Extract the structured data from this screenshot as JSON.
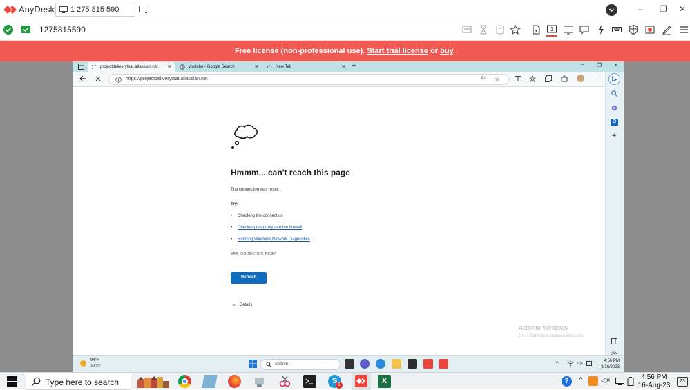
{
  "anydesk": {
    "app_name": "AnyDesk",
    "address": "1 275 815 590",
    "session_id": "1275815590",
    "brand_color": "#ef443b",
    "window_controls": [
      "–",
      "❐",
      "✕"
    ],
    "toolbar_icons": [
      "chat-disabled-icon",
      "hourglass-icon",
      "database-icon",
      "star-icon",
      "file-transfer-icon",
      "monitor-select-icon",
      "display-icon",
      "chat-icon",
      "actions-icon",
      "keyboard-icon",
      "permissions-icon",
      "record-icon",
      "whiteboard-icon",
      "menu-icon"
    ]
  },
  "banner": {
    "prefix": "Free license (non-professional use). ",
    "trial_link": "Start trial license",
    "mid": " or ",
    "buy_link": "buy",
    "suffix": ".",
    "color": "#f15a53"
  },
  "browser": {
    "tabs": [
      {
        "label": "projectdeliverytsat.atlassian.net",
        "active": true
      },
      {
        "label": "youtube - Google Search",
        "active": false
      },
      {
        "label": "New Tab",
        "active": false
      }
    ],
    "url": "https://projectdeliverytsat.atlassian.net"
  },
  "error_page": {
    "title": "Hmmm... can't reach this page",
    "message": "The connection was reset.",
    "try_label": "Try:",
    "suggestions": [
      {
        "text": "Checking the connection",
        "link": false
      },
      {
        "text": "Checking the proxy and the firewall",
        "link": true
      },
      {
        "text": "Running Windows Network Diagnostics",
        "link": true
      }
    ],
    "error_code": "ERR_CONNECTION_RESET",
    "refresh_label": "Refresh",
    "details_label": "Details"
  },
  "watermark": {
    "title": "Activate Windows",
    "subtitle": "Go to Settings to activate Windows."
  },
  "remote_taskbar": {
    "temperature": "94°F",
    "condition": "Sunny",
    "search_label": "Search",
    "time": "4:56 PM",
    "date": "8/16/2023"
  },
  "local_taskbar": {
    "search_placeholder": "Type here to search",
    "time": "4:56 PM",
    "date": "16-Aug-23",
    "notification_count": "23",
    "skype_badge": "1"
  }
}
